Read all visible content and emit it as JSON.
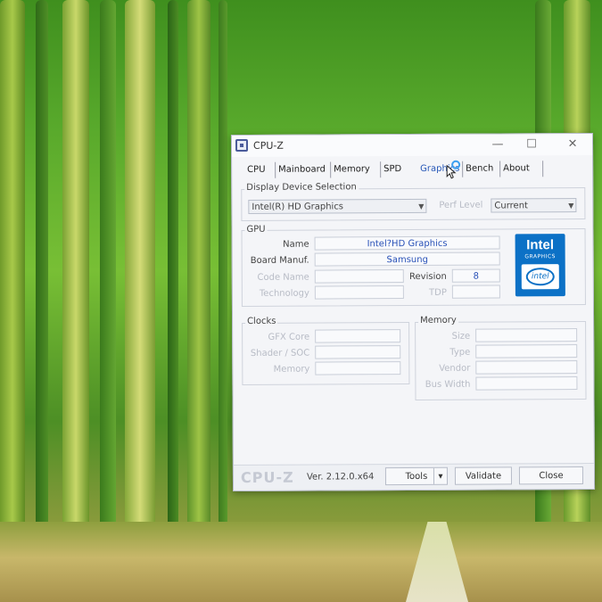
{
  "window": {
    "title": "CPU-Z",
    "minimize": "—",
    "maximize": "☐",
    "close": "✕"
  },
  "tabs": [
    "CPU",
    "Mainboard",
    "Memory",
    "SPD",
    "Graphics",
    "Bench",
    "About"
  ],
  "active_tab": "Graphics",
  "display": {
    "group_label": "Display Device Selection",
    "device": "Intel(R) HD Graphics",
    "perf_label": "Perf Level",
    "perf_value": "Current"
  },
  "gpu": {
    "group_label": "GPU",
    "name_label": "Name",
    "name_value": "Intel?HD Graphics",
    "board_label": "Board Manuf.",
    "board_value": "Samsung",
    "code_label": "Code Name",
    "revision_label": "Revision",
    "revision_value": "8",
    "tech_label": "Technology",
    "tdp_label": "TDP"
  },
  "logo": {
    "brand": "Intel",
    "sub": "GRAPHICS",
    "badge": "intel"
  },
  "clocks": {
    "group_label": "Clocks",
    "core_label": "GFX Core",
    "shader_label": "Shader / SOC",
    "memory_label": "Memory"
  },
  "memory": {
    "group_label": "Memory",
    "size_label": "Size",
    "type_label": "Type",
    "vendor_label": "Vendor",
    "bus_label": "Bus Width"
  },
  "footer": {
    "logo": "CPU-Z",
    "version": "Ver. 2.12.0.x64",
    "tools": "Tools",
    "tools_arrow": "▾",
    "validate": "Validate",
    "close": "Close"
  },
  "icons": {
    "app": "cpu-z-app-icon",
    "cursor": "busy-cursor-icon",
    "dropdown": "chevron-down-icon"
  }
}
